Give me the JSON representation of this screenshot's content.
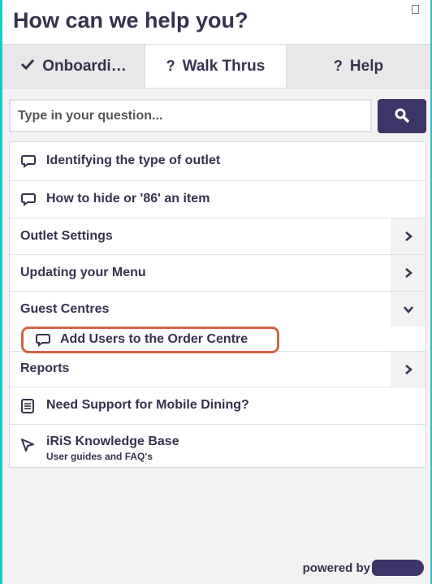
{
  "header": {
    "title": "How can we help you?"
  },
  "tabs": [
    {
      "label": "Onboardi…",
      "icon": "checkmark-icon"
    },
    {
      "label": "Walk Thrus",
      "icon": "question-icon"
    },
    {
      "label": "Help",
      "icon": "question-icon"
    }
  ],
  "search": {
    "placeholder": "Type in your question..."
  },
  "items": {
    "item1": {
      "label": "Identifying the type of outlet",
      "icon": "chat-bubble-icon"
    },
    "item2": {
      "label": "How to hide or '86' an item",
      "icon": "chat-bubble-icon"
    },
    "outlet_settings": {
      "label": "Outlet Settings"
    },
    "updating_menu": {
      "label": "Updating your Menu"
    },
    "guest_centres": {
      "label": "Guest Centres"
    },
    "add_users": {
      "label": "Add Users to the Order Centre",
      "icon": "chat-bubble-icon"
    },
    "reports": {
      "label": "Reports"
    },
    "mobile_dining": {
      "label": "Need Support for Mobile Dining?",
      "icon": "document-icon"
    },
    "knowledge_base": {
      "label": "iRiS Knowledge Base",
      "sublabel": "User guides and FAQ's",
      "icon": "cursor-icon"
    }
  },
  "footer": {
    "powered_by": "powered by"
  },
  "colors": {
    "accent": "#23c4c0",
    "brand": "#3b3667",
    "highlight": "#d1634a",
    "text": "#33334d"
  }
}
